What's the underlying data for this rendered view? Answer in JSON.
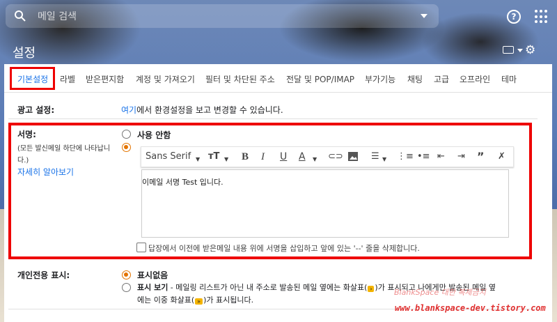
{
  "search": {
    "placeholder": "메일 검색"
  },
  "header": {
    "title": "설정",
    "help_icon": "help-circle-icon",
    "apps_icon": "apps-grid-icon",
    "settings_icon": "gear-icon"
  },
  "tabs": [
    {
      "label": "기본설정",
      "active": true
    },
    {
      "label": "라벨"
    },
    {
      "label": "받은편지함"
    },
    {
      "label": "계정 및 가져오기"
    },
    {
      "label": "필터 및 차단된 주소"
    },
    {
      "label": "전달 및 POP/IMAP"
    },
    {
      "label": "부가기능"
    },
    {
      "label": "채팅"
    },
    {
      "label": "고급"
    },
    {
      "label": "오프라인"
    },
    {
      "label": "테마"
    }
  ],
  "ads": {
    "label": "광고 설정:",
    "link": "여기",
    "text": "에서 환경설정을 보고 변경할 수 있습니다."
  },
  "signature": {
    "label": "서명:",
    "desc_line1": "(모든 발신메일 하단에 나타납니",
    "desc_line2": "다.)",
    "learn_more": "자세히 알아보기",
    "option_none": "사용 안함",
    "toolbar": {
      "font": "Sans Serif",
      "size_icon": "text-size-icon"
    },
    "editor_text": "이메일 서명 Test 입니다.",
    "checkbox_label": "답장에서 이전에 받은메일 내용 위에 서명을 삽입하고 앞에 있는 '--' 줄을 삭제합니다."
  },
  "personal": {
    "label": "개인전용 표시:",
    "option_none": "표시없음",
    "option_show_title": "표시 보기",
    "option_show_desc_1": " - 메일링 리스트가 아닌 내 주소로 발송된 메일 옆에는 화살표(",
    "arrow_single": "›",
    "option_show_desc_2": ")가 표시되고 나에게만 발송된 메일 옆",
    "option_show_desc_line2_a": "에는 이중 화살표(",
    "arrow_double": "»",
    "option_show_desc_line2_b": ")가 표시됩니다."
  },
  "watermark": {
    "ghost": "BlankSpace 대한 복제금지",
    "url": "www.blankspace-dev.tistory.com"
  },
  "colors": {
    "accent": "#1a73e8",
    "highlight": "#e00000",
    "radio": "#e37400"
  }
}
